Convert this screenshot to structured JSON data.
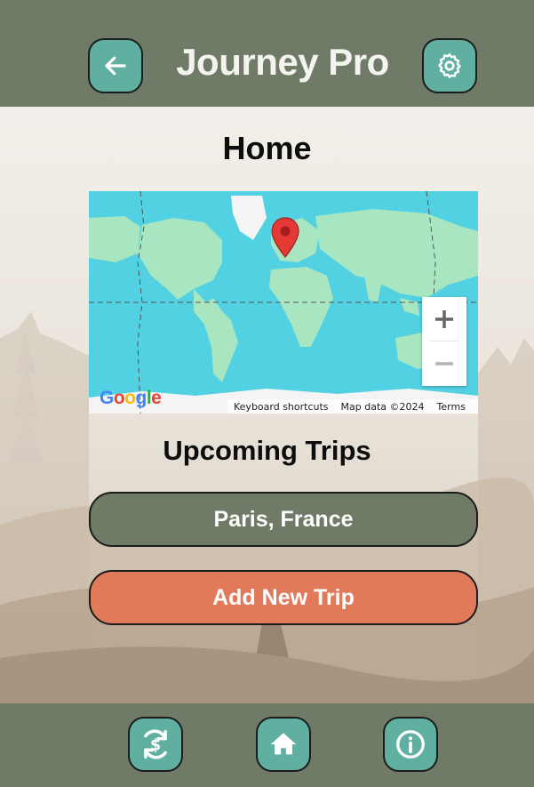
{
  "header": {
    "title": "Journey Pro",
    "back_icon": "arrow-left-icon",
    "settings_icon": "gear-icon"
  },
  "main": {
    "page_title": "Home",
    "map": {
      "logo": "Google",
      "footer_links": [
        "Keyboard shortcuts",
        "Map data ©2024",
        "Terms"
      ],
      "zoom_in_icon": "plus-icon",
      "zoom_out_icon": "minus-icon",
      "marker_icon": "map-pin-icon"
    },
    "section_title": "Upcoming Trips",
    "trips": [
      {
        "label": "Paris, France"
      }
    ],
    "add_trip_label": "Add New Trip"
  },
  "footer": {
    "nav": [
      {
        "icon": "currency-exchange-icon"
      },
      {
        "icon": "home-icon"
      },
      {
        "icon": "info-icon"
      }
    ]
  },
  "colors": {
    "header_bg": "#6f7b66",
    "accent_teal": "#5fb0a1",
    "accent_orange": "#e07a5a",
    "page_bg": "#f1ede7",
    "map_ocean": "#52d1e3",
    "map_land": "#a8e6c1",
    "marker": "#e53935"
  }
}
